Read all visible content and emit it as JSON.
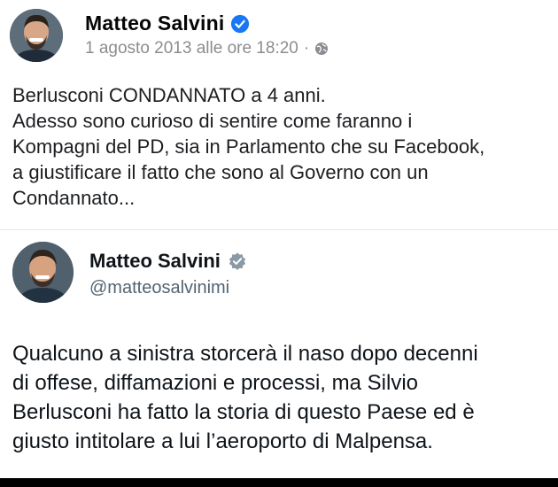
{
  "colors": {
    "facebook_verified_badge": "#1877f2",
    "x_verified_badge": "#8b98a5",
    "meta_text": "#8a8d91",
    "handle_text": "#536471"
  },
  "facebook_post": {
    "author_name": "Matteo Salvini",
    "timestamp": "1 agosto 2013 alle ore 18:20",
    "separator": "·",
    "audience_icon": "globe-icon",
    "verified_icon": "verified-badge-icon",
    "lines": [
      "Berlusconi CONDANNATO a 4 anni.",
      "Adesso sono curioso di sentire come faranno i",
      "Kompagni del PD, sia in Parlamento che su Facebook,",
      "a giustificare il fatto che sono al Governo con un",
      "Condannato..."
    ]
  },
  "x_post": {
    "author_name": "Matteo Salvini",
    "handle": "@matteosalvinimi",
    "verified_icon": "verified-badge-icon",
    "lines": [
      "Qualcuno a sinistra storcerà il naso dopo decenni",
      "di offese, diffamazioni e processi, ma Silvio",
      "Berlusconi ha fatto la storia di questo Paese ed è",
      "giusto intitolare a lui l’aeroporto di Malpensa."
    ]
  }
}
